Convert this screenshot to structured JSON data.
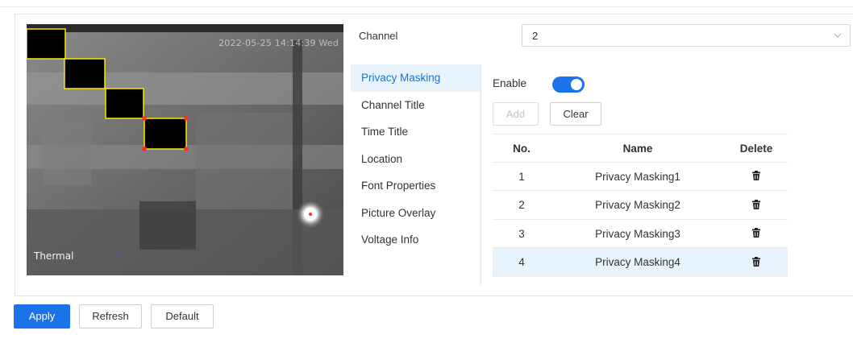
{
  "channel": {
    "label": "Channel",
    "value": "2"
  },
  "preview": {
    "timestamp": "2022-05-25 14:14:39 Wed",
    "camera_label": "Thermal"
  },
  "nav": {
    "items": [
      {
        "label": "Privacy Masking",
        "active": true
      },
      {
        "label": "Channel Title",
        "active": false
      },
      {
        "label": "Time Title",
        "active": false
      },
      {
        "label": "Location",
        "active": false
      },
      {
        "label": "Font Properties",
        "active": false
      },
      {
        "label": "Picture Overlay",
        "active": false
      },
      {
        "label": "Voltage Info",
        "active": false
      }
    ]
  },
  "privacy": {
    "enable_label": "Enable",
    "enabled": true,
    "add_label": "Add",
    "clear_label": "Clear",
    "table": {
      "headers": {
        "no": "No.",
        "name": "Name",
        "delete": "Delete"
      },
      "rows": [
        {
          "no": "1",
          "name": "Privacy Masking1"
        },
        {
          "no": "2",
          "name": "Privacy Masking2"
        },
        {
          "no": "3",
          "name": "Privacy Masking3"
        },
        {
          "no": "4",
          "name": "Privacy Masking4"
        }
      ],
      "selected_index": 3
    }
  },
  "footer": {
    "apply_label": "Apply",
    "refresh_label": "Refresh",
    "default_label": "Default"
  },
  "colors": {
    "accent": "#1a73e8",
    "selected_row": "#e8f4fc",
    "mask_border": "#ffe600",
    "handle": "#ff2a2a"
  },
  "icons": {
    "select_chevron": "chevron-down-icon",
    "delete": "trash-icon"
  }
}
